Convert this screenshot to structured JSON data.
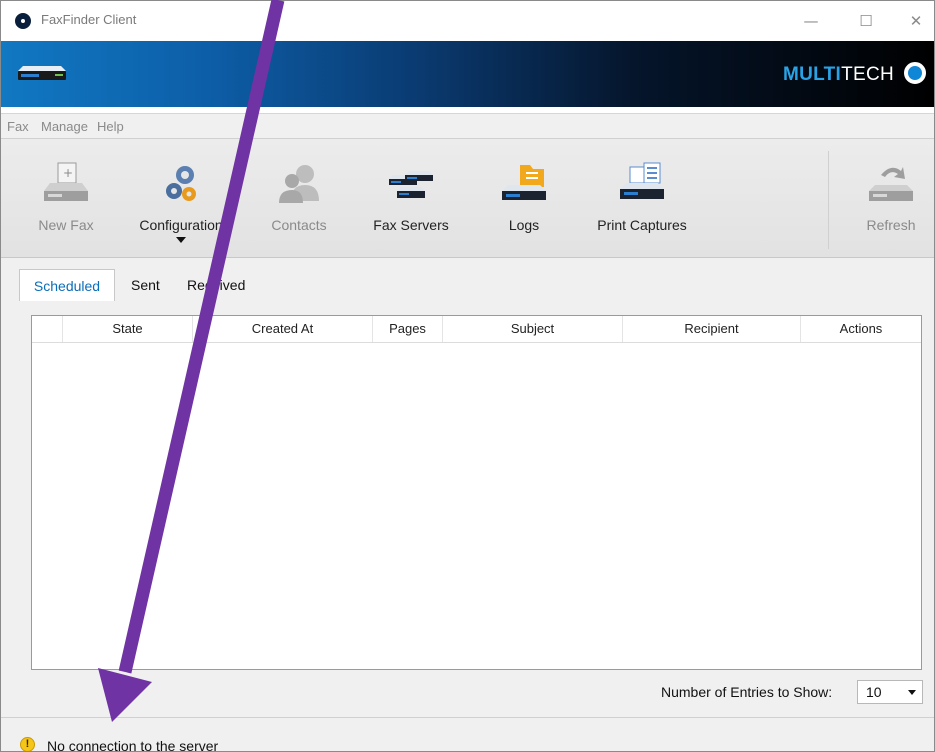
{
  "window": {
    "title": "FaxFinder Client",
    "controls": {
      "minimize": "—",
      "maximize": "☐",
      "close": "✕"
    }
  },
  "banner": {
    "brand_bold": "MULTI",
    "brand_light": "TECH",
    "icon": "faxfinder-device-icon"
  },
  "menu": {
    "items": [
      "Fax",
      "Manage",
      "Help"
    ]
  },
  "toolbar": {
    "buttons": [
      {
        "label": "New Fax",
        "icon": "new-fax-icon",
        "enabled": false
      },
      {
        "label": "Configuration",
        "icon": "gears-icon",
        "enabled": true
      },
      {
        "label": "Contacts",
        "icon": "contacts-icon",
        "enabled": false
      },
      {
        "label": "Fax Servers",
        "icon": "fax-servers-icon",
        "enabled": true
      },
      {
        "label": "Logs",
        "icon": "logs-folder-icon",
        "enabled": true
      },
      {
        "label": "Print Captures",
        "icon": "print-captures-icon",
        "enabled": true
      },
      {
        "label": "Refresh",
        "icon": "refresh-icon",
        "enabled": false
      }
    ]
  },
  "tabs": {
    "items": [
      "Scheduled",
      "Sent",
      "Received"
    ],
    "active": "Scheduled"
  },
  "table": {
    "columns": [
      "",
      "State",
      "Created At",
      "Pages",
      "Subject",
      "Recipient",
      "Actions"
    ],
    "rows": []
  },
  "footer": {
    "entries_label": "Number of Entries to Show:",
    "entries_value": "10"
  },
  "status": {
    "icon": "warning-icon",
    "icon_glyph": "!",
    "text": "No connection to the server"
  },
  "colors": {
    "accent": "#0c6db8",
    "annotation_arrow": "#6f33a3",
    "warning": "#f5c518"
  }
}
